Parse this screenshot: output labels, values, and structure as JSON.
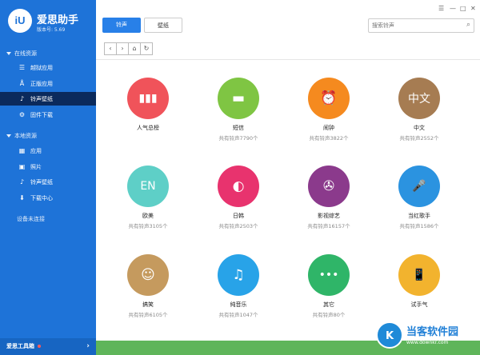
{
  "sidebar": {
    "logo_text": "iU",
    "app_name": "爱思助手",
    "version": "版本号: 5.69",
    "section_online": "在线资源",
    "online_items": [
      {
        "icon": "layers-icon",
        "glyph": "☰",
        "label": "越狱应用"
      },
      {
        "icon": "appstore-icon",
        "glyph": "Å",
        "label": "正版应用"
      },
      {
        "icon": "ringtone-wallpaper-icon",
        "glyph": "♪",
        "label": "铃声壁纸"
      },
      {
        "icon": "firmware-download-icon",
        "glyph": "⚙",
        "label": "固件下载"
      }
    ],
    "section_local": "本地资源",
    "local_items": [
      {
        "icon": "apps-icon",
        "glyph": "▦",
        "label": "应用"
      },
      {
        "icon": "photo-icon",
        "glyph": "▣",
        "label": "照片"
      },
      {
        "icon": "ringtone-wallpaper-icon",
        "glyph": "♪",
        "label": "铃声壁纸"
      },
      {
        "icon": "download-center-icon",
        "glyph": "⬇",
        "label": "下载中心"
      }
    ],
    "device_status": "设备未连接",
    "toolbox_label": "爱思工具箱"
  },
  "tabs": {
    "ringtone": "铃声",
    "wallpaper": "壁纸"
  },
  "search": {
    "placeholder": "搜索铃声"
  },
  "window_controls": [
    "☰",
    "—",
    "□",
    "✕"
  ],
  "categories": [
    {
      "name": "人气总榜",
      "count": "",
      "color": "#f0535a",
      "icon": "bar-chart-icon",
      "glyph": "▮▮▮"
    },
    {
      "name": "短信",
      "count": "共有铃声7790个",
      "color": "#7fc543",
      "icon": "message-icon",
      "glyph": "▬"
    },
    {
      "name": "闹钟",
      "count": "共有铃声3822个",
      "color": "#f58a1f",
      "icon": "alarm-clock-icon",
      "glyph": "⏰"
    },
    {
      "name": "中文",
      "count": "共有铃声2552个",
      "color": "#a67c52",
      "icon": "chinese-text-icon",
      "glyph": "中文"
    },
    {
      "name": "欧美",
      "count": "共有铃声3105个",
      "color": "#5ecfc7",
      "icon": "en-text-icon",
      "glyph": "EN"
    },
    {
      "name": "日韩",
      "count": "共有铃声2503个",
      "color": "#e8336e",
      "icon": "swirl-icon",
      "glyph": "◐"
    },
    {
      "name": "影视综艺",
      "count": "共有铃声16157个",
      "color": "#8b3a8c",
      "icon": "film-reel-icon",
      "glyph": "✇"
    },
    {
      "name": "当红歌手",
      "count": "共有铃声1586个",
      "color": "#2b93e0",
      "icon": "microphone-icon",
      "glyph": "🎤"
    },
    {
      "name": "搞笑",
      "count": "共有铃声6105个",
      "color": "#c59a5e",
      "icon": "smiley-icon",
      "glyph": "☺"
    },
    {
      "name": "纯音乐",
      "count": "共有铃声1047个",
      "color": "#28a3e8",
      "icon": "music-note-icon",
      "glyph": "♫"
    },
    {
      "name": "其它",
      "count": "共有铃声80个",
      "color": "#2fb568",
      "icon": "more-dots-icon",
      "glyph": "•••"
    },
    {
      "name": "试手气",
      "count": "",
      "color": "#f2b32e",
      "icon": "shake-phone-icon",
      "glyph": "📱"
    }
  ],
  "watermark": {
    "logo": "K",
    "name": "当客软件园",
    "url": "www.downkr.com"
  }
}
